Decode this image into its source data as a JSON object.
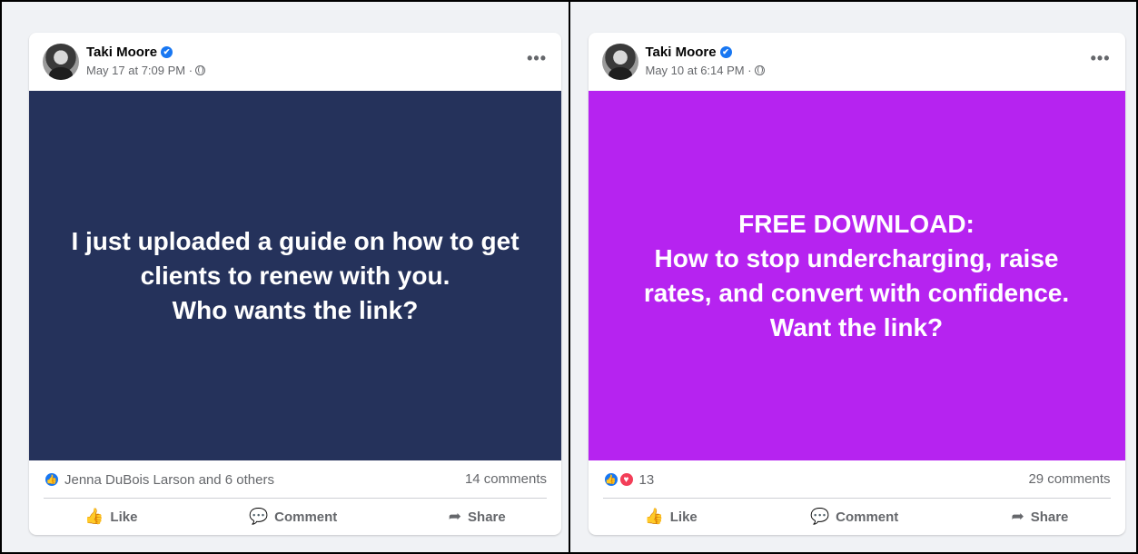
{
  "posts": [
    {
      "author": "Taki Moore",
      "timestamp": "May 17 at 7:09 PM ·",
      "background": "#25325b",
      "text": "I just uploaded a guide on how to get\nclients to renew with you.\nWho wants the link?",
      "reactions_text": "Jenna DuBois Larson and 6 others",
      "comments": "14 comments",
      "actions": {
        "like": "Like",
        "comment": "Comment",
        "share": "Share"
      }
    },
    {
      "author": "Taki Moore",
      "timestamp": "May 10 at 6:14 PM ·",
      "background": "#b623f0",
      "text": "FREE DOWNLOAD:\nHow to stop undercharging, raise\nrates, and convert with confidence.\nWant the link?",
      "reactions_text": "13",
      "comments": "29 comments",
      "actions": {
        "like": "Like",
        "comment": "Comment",
        "share": "Share"
      }
    }
  ],
  "icons": {
    "verified": "✔",
    "more": "•••",
    "like_reaction": "👍",
    "love_reaction": "♥",
    "like": "👍",
    "comment": "💬",
    "share": "➦"
  },
  "colors": {
    "brand_blue": "#1877f2",
    "love_red": "#f33e58",
    "muted_text": "#65676b"
  }
}
